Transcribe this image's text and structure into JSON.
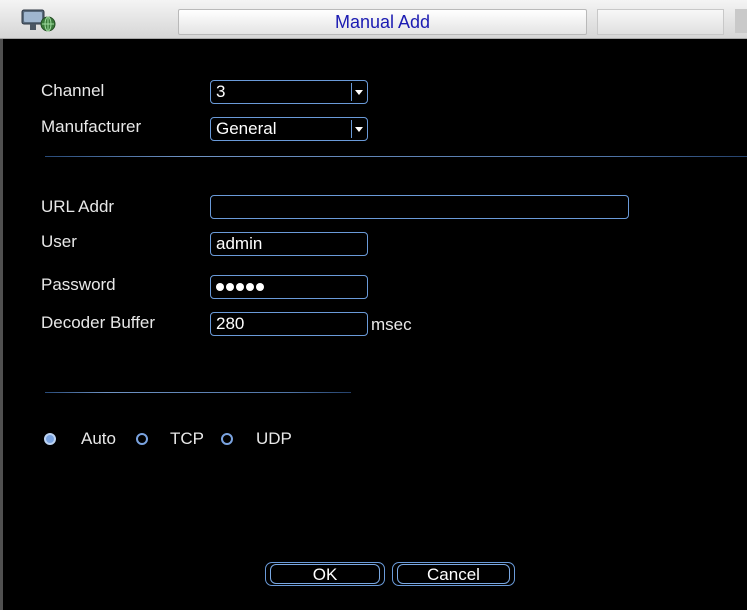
{
  "window": {
    "title": "Manual Add"
  },
  "form": {
    "channel_label": "Channel",
    "channel_value": "3",
    "manufacturer_label": "Manufacturer",
    "manufacturer_value": "General",
    "url_label": "URL Addr",
    "url_value": "",
    "user_label": "User",
    "user_value": "admin",
    "password_label": "Password",
    "password_masked_length": 5,
    "buffer_label": "Decoder Buffer",
    "buffer_value": "280",
    "buffer_unit": "msec"
  },
  "protocol": {
    "selected": "Auto",
    "options": [
      "Auto",
      "TCP",
      "UDP"
    ]
  },
  "buttons": {
    "ok_label": "OK",
    "cancel_label": "Cancel"
  },
  "icons": {
    "app_icon": "network-camera-icon",
    "dropdown": "chevron-down-icon"
  },
  "colors": {
    "background": "#000000",
    "title_text": "#1b1bb2",
    "accent_border": "#6a9ad8",
    "label_text": "#e8e8e8"
  }
}
